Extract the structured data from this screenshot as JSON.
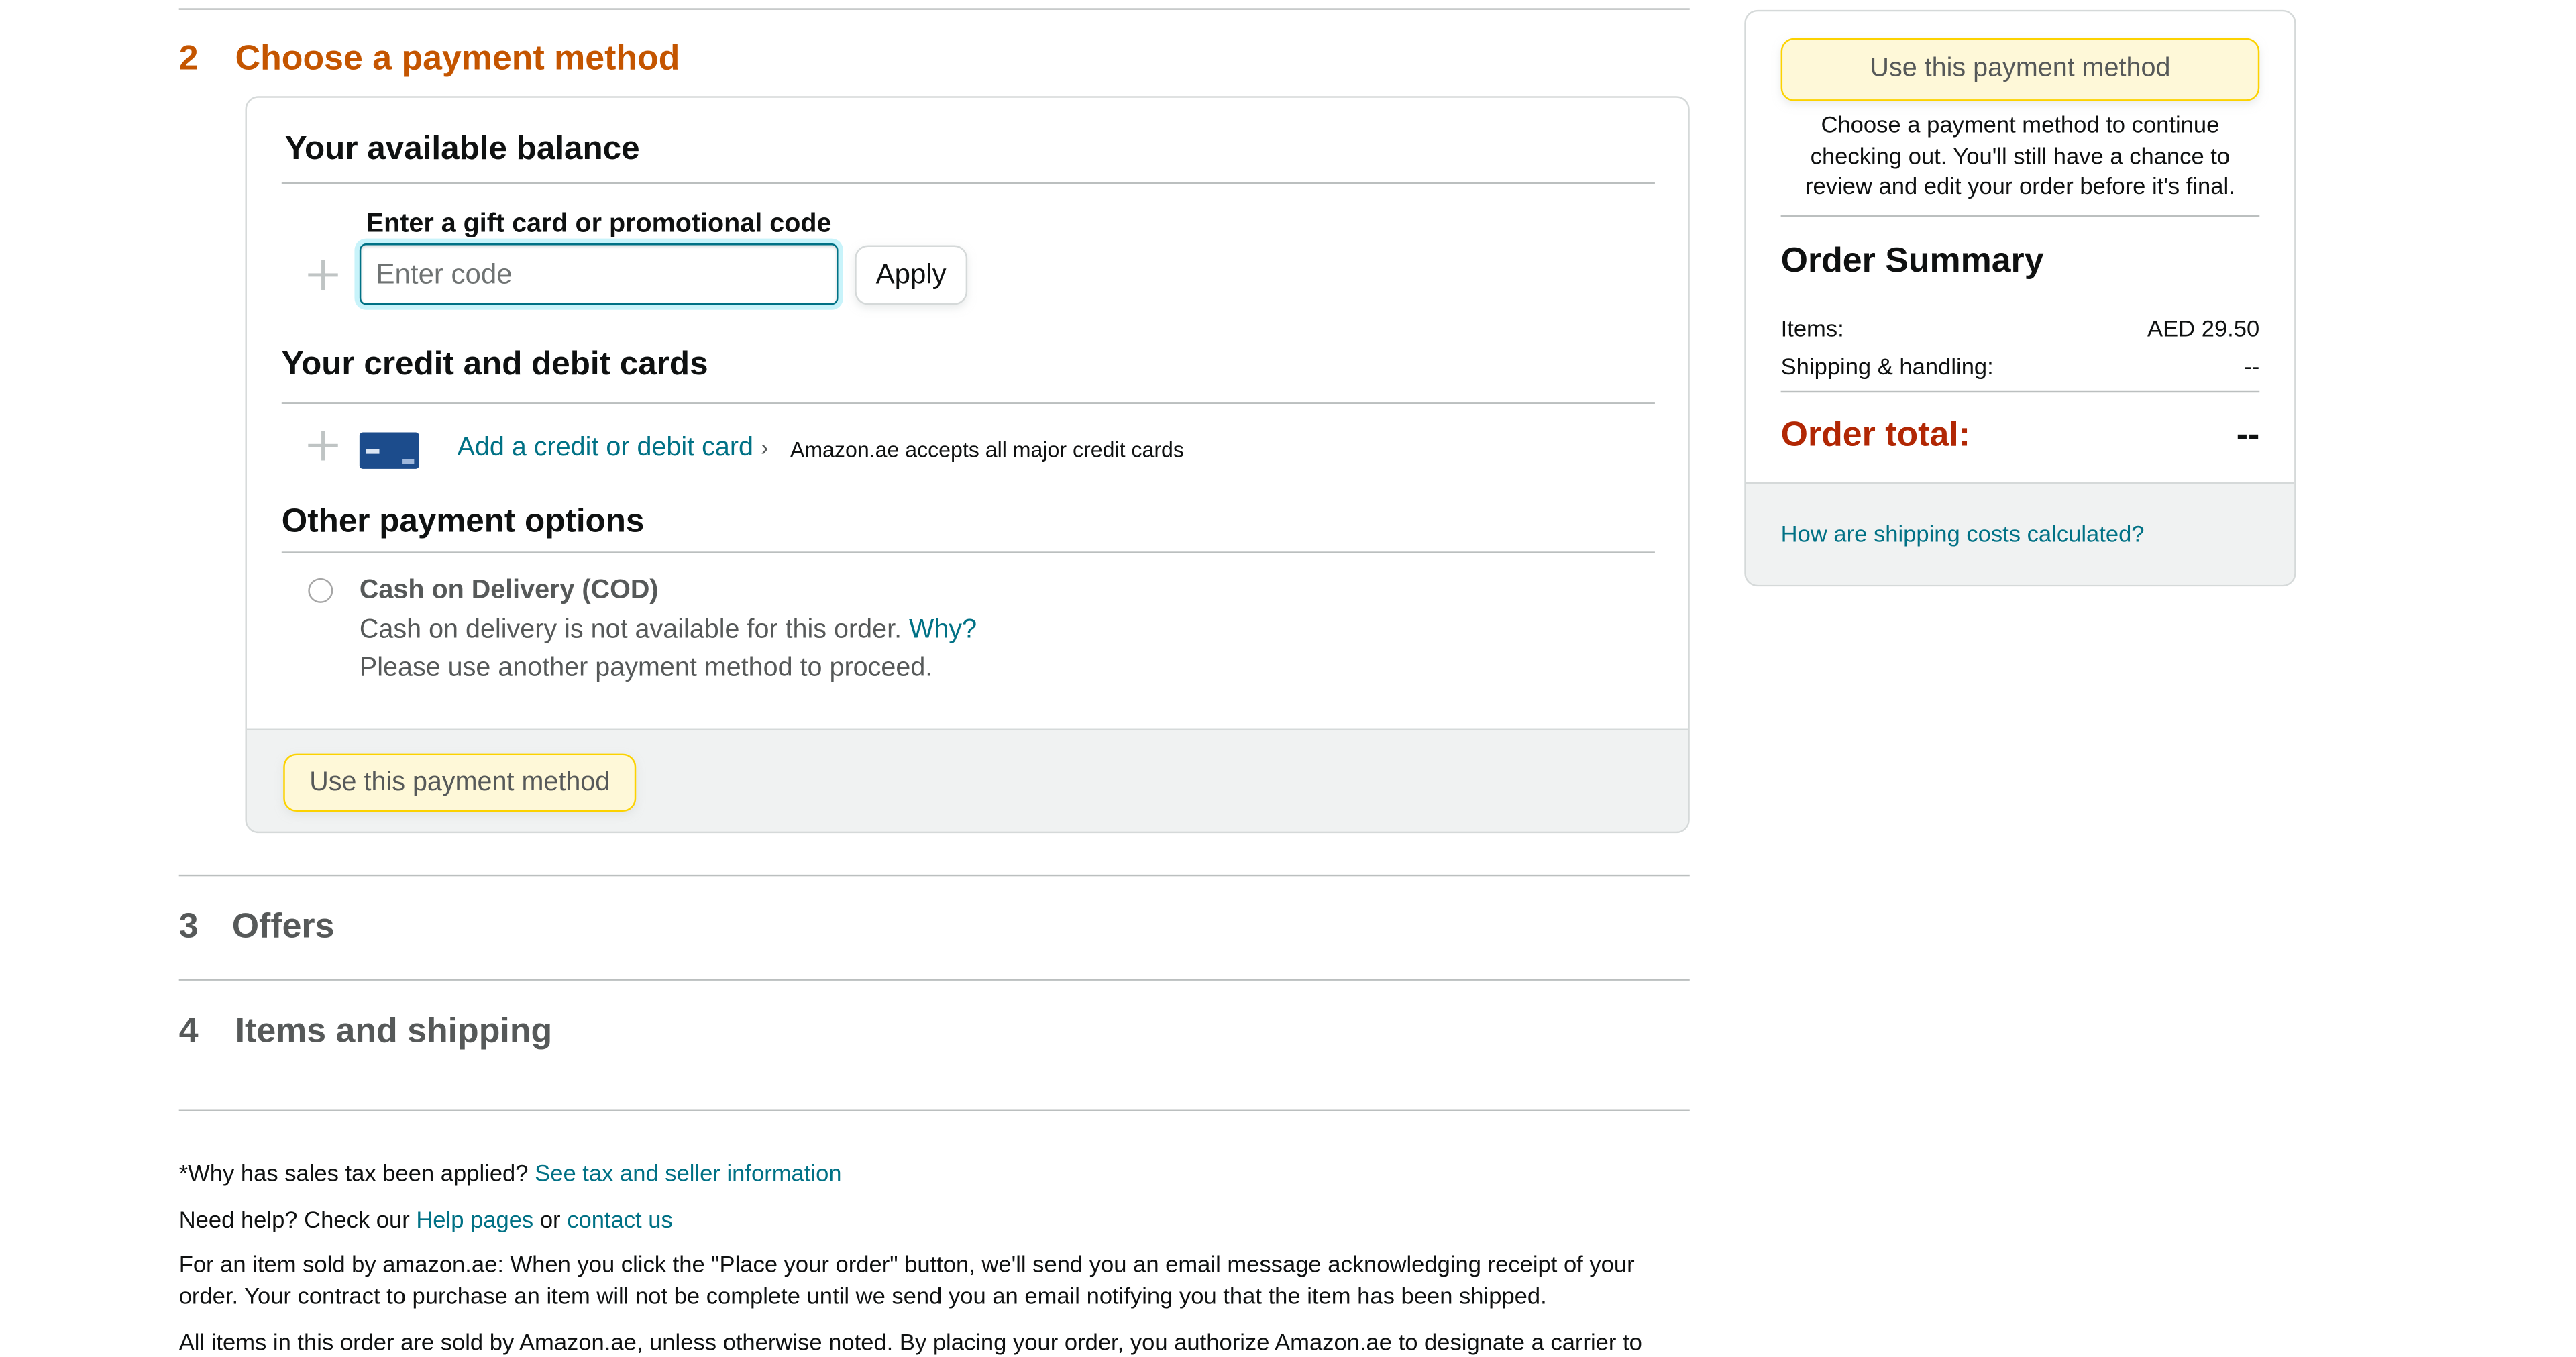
{
  "payment_step": {
    "number": "2",
    "title": "Choose a payment method",
    "balance": {
      "heading": "Your available balance",
      "code_label": "Enter a gift card or promotional code",
      "code_placeholder": "Enter code",
      "apply_label": "Apply"
    },
    "cards": {
      "heading": "Your credit and debit cards",
      "add_card_label": "Add a credit or debit card",
      "add_card_chevron": "›",
      "accepts_text": "Amazon.ae accepts all major credit cards"
    },
    "other": {
      "heading": "Other payment options",
      "cod_title": "Cash on Delivery (COD)",
      "cod_unavailable": "Cash on delivery is not available for this order.",
      "why_link": "Why?",
      "cod_hint": "Please use another payment method to proceed."
    },
    "use_method_label": "Use this payment method"
  },
  "offers_step": {
    "number": "3",
    "title": "Offers"
  },
  "items_step": {
    "number": "4",
    "title": "Items and shipping"
  },
  "footer": {
    "tax_question": "*Why has sales tax been applied?",
    "tax_link": "See tax and seller information",
    "help_prefix": "Need help? Check our",
    "help_link": "Help pages",
    "help_or": "or",
    "contact_link": "contact us",
    "para1": "For an item sold by amazon.ae: When you click the \"Place your order\" button, we'll send you an email message acknowledging receipt of your order. Your contract to purchase an item will not be complete until we send you an email notifying you that the item has been shipped.",
    "para2": "All items in this order are sold by Amazon.ae, unless otherwise noted. By placing your order, you authorize Amazon.ae to designate a carrier to clear the package and pay the import fees on your (or the recipient's) behalf. Customs declarations will be made in the name and on behalf of you"
  },
  "sidebar": {
    "use_method_label": "Use this payment method",
    "hint": "Choose a payment method to continue checking out. You'll still have a chance to review and edit your order before it's final.",
    "summary_title": "Order Summary",
    "items_label": "Items:",
    "items_value": "AED 29.50",
    "shipping_label": "Shipping & handling:",
    "shipping_value": "--",
    "total_label": "Order total:",
    "total_value": "--",
    "shipping_costs_link": "How are shipping costs calculated?"
  },
  "colors": {
    "accent_orange": "#c45500",
    "link_teal": "#007185",
    "total_red": "#b12704",
    "button_yellow": "#fef8d8"
  }
}
